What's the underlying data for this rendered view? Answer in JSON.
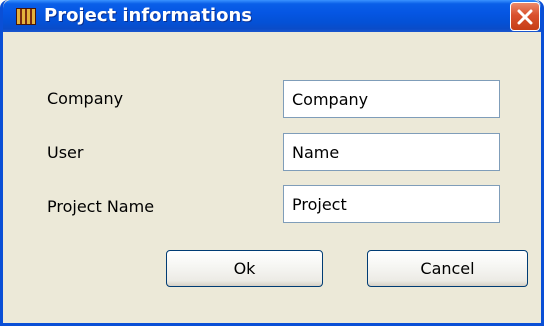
{
  "window": {
    "title": "Project informations",
    "app_icon": "books-icon",
    "close_icon": "close-icon",
    "accent_color": "#0a4fd6",
    "close_color": "#d9512d"
  },
  "form": {
    "company": {
      "label": "Company",
      "value": "Company"
    },
    "user": {
      "label": "User",
      "value": "Name"
    },
    "project_name": {
      "label": "Project Name",
      "value": "Project"
    }
  },
  "buttons": {
    "ok": "Ok",
    "cancel": "Cancel"
  }
}
